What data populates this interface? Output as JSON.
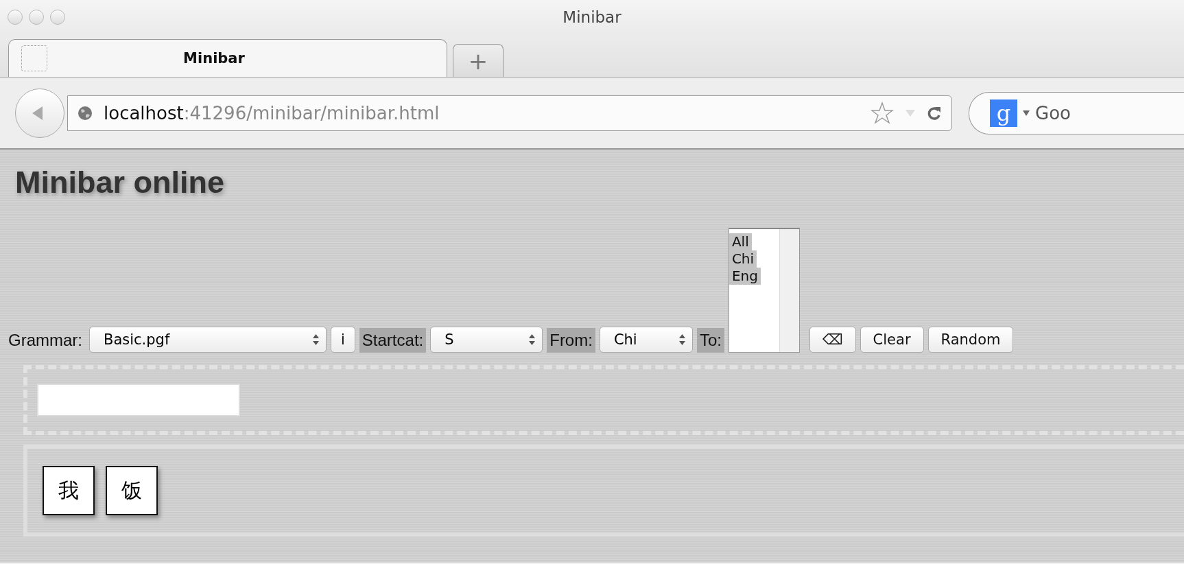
{
  "window": {
    "title": "Minibar"
  },
  "tabs": [
    {
      "label": "Minibar",
      "selected": true
    }
  ],
  "new_tab_button": "+",
  "address_bar": {
    "host": "localhost",
    "path": ":41296/minibar/minibar.html"
  },
  "search_field": {
    "engine_badge": "g",
    "placeholder": "Goo"
  },
  "page": {
    "heading": "Minibar online",
    "toolbar": {
      "grammar": {
        "label": "Grammar:",
        "highlighted": false,
        "value": "Basic.pgf"
      },
      "info_button": "i",
      "startcat": {
        "label": "Startcat:",
        "highlighted": true,
        "value": "S"
      },
      "from": {
        "label": "From:",
        "highlighted": true,
        "value": "Chi"
      },
      "to": {
        "label": "To:",
        "highlighted": true,
        "options": [
          {
            "label": "All",
            "selected": true
          },
          {
            "label": "Chi",
            "selected": true
          },
          {
            "label": "Eng",
            "selected": true
          }
        ]
      },
      "buttons": [
        "⌫",
        "Clear",
        "Random"
      ]
    },
    "words": [
      "我",
      "饭"
    ]
  }
}
